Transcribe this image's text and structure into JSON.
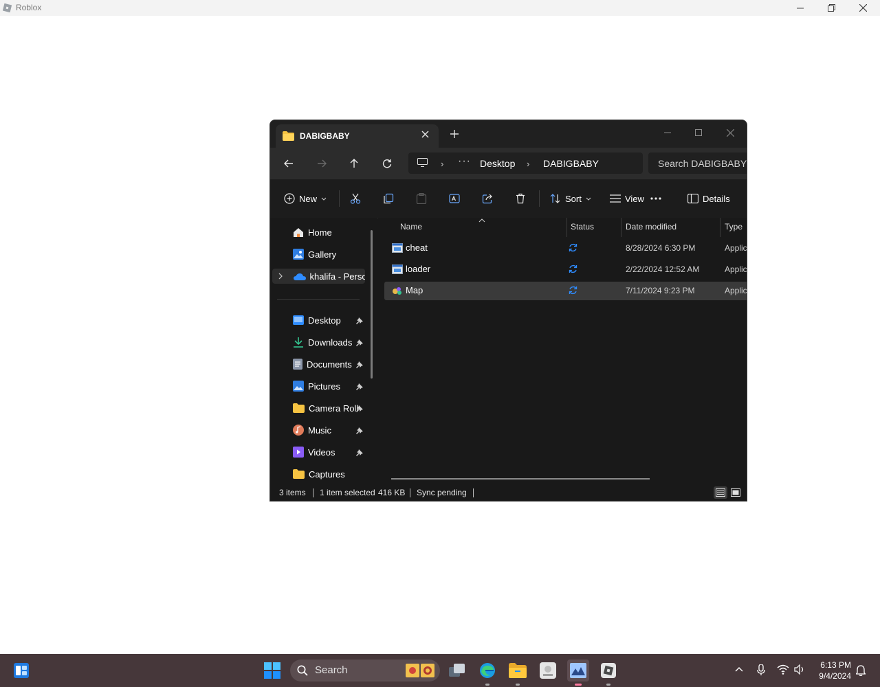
{
  "app": {
    "title": "Roblox"
  },
  "explorer": {
    "tab_title": "DABIGBABY",
    "breadcrumb": [
      "Desktop",
      "DABIGBABY"
    ],
    "search_placeholder": "Search DABIGBABY",
    "toolbar": {
      "new_label": "New",
      "sort_label": "Sort",
      "view_label": "View",
      "details_label": "Details"
    },
    "sidebar": {
      "top_items": [
        {
          "label": "Home",
          "icon": "home-icon"
        },
        {
          "label": "Gallery",
          "icon": "gallery-icon"
        },
        {
          "label": "khalifa - Persona",
          "icon": "onedrive-icon"
        }
      ],
      "pinned_items": [
        {
          "label": "Desktop",
          "icon": "desktop-folder-icon"
        },
        {
          "label": "Downloads",
          "icon": "downloads-icon"
        },
        {
          "label": "Documents",
          "icon": "documents-icon"
        },
        {
          "label": "Pictures",
          "icon": "pictures-icon"
        },
        {
          "label": "Camera Roll",
          "icon": "folder-icon"
        },
        {
          "label": "Music",
          "icon": "music-icon"
        },
        {
          "label": "Videos",
          "icon": "videos-icon"
        },
        {
          "label": "Captures",
          "icon": "folder-icon"
        }
      ]
    },
    "columns": {
      "name": "Name",
      "status": "Status",
      "date": "Date modified",
      "type": "Type"
    },
    "files": [
      {
        "name": "cheat",
        "date": "8/28/2024 6:30 PM",
        "type": "Applic",
        "selected": false
      },
      {
        "name": "loader",
        "date": "2/22/2024 12:52 AM",
        "type": "Applic",
        "selected": false
      },
      {
        "name": "Map",
        "date": "7/11/2024 9:23 PM",
        "type": "Applic",
        "selected": true
      }
    ],
    "statusbar": {
      "items": "3 items",
      "selected": "1 item selected",
      "size": "416 KB",
      "sync": "Sync pending"
    }
  },
  "taskbar": {
    "search_label": "Search",
    "time": "6:13 PM",
    "date": "9/4/2024"
  },
  "colors": {
    "explorer_bg": "#191919",
    "taskbar_bg": "#46373a",
    "accent": "#2f8cff",
    "folder": "#f6c342"
  }
}
